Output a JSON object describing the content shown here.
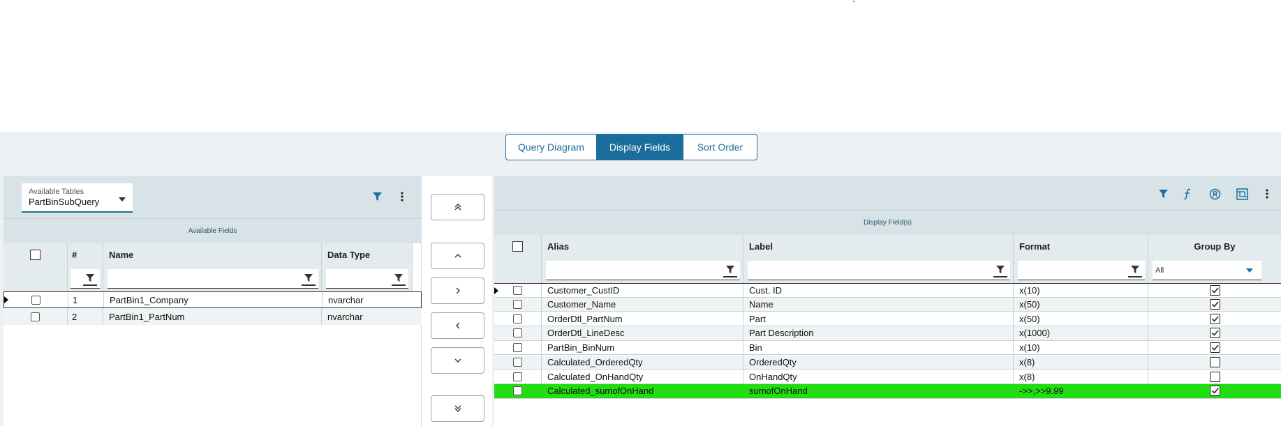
{
  "tabs": [
    {
      "label": "Query Diagram",
      "active": false
    },
    {
      "label": "Display Fields",
      "active": true
    },
    {
      "label": "Sort Order",
      "active": false
    }
  ],
  "left": {
    "table_select": {
      "label": "Available Tables",
      "value": "PartBinSubQuery"
    },
    "section_title": "Available Fields",
    "columns": [
      "#",
      "Name",
      "Data Type"
    ],
    "rows": [
      {
        "num": "1",
        "name": "PartBin1_Company",
        "type": "nvarchar"
      },
      {
        "num": "2",
        "name": "PartBin1_PartNum",
        "type": "nvarchar"
      }
    ]
  },
  "middle": {
    "buttons": [
      "move-all-up",
      "move-up",
      "add",
      "remove",
      "move-down",
      "move-all-down"
    ]
  },
  "right": {
    "section_title": "Display Field(s)",
    "columns": [
      "Alias",
      "Label",
      "Format",
      "Group By"
    ],
    "group_filter_value": "All",
    "rows": [
      {
        "alias": "Customer_CustID",
        "label": "Cust. ID",
        "format": "x(10)",
        "group_by": true
      },
      {
        "alias": "Customer_Name",
        "label": "Name",
        "format": "x(50)",
        "group_by": true
      },
      {
        "alias": "OrderDtl_PartNum",
        "label": "Part",
        "format": "x(50)",
        "group_by": true
      },
      {
        "alias": "OrderDtl_LineDesc",
        "label": "Part Description",
        "format": "x(1000)",
        "group_by": true
      },
      {
        "alias": "PartBin_BinNum",
        "label": "Bin",
        "format": "x(10)",
        "group_by": true
      },
      {
        "alias": "Calculated_OrderedQty",
        "label": "OrderedQty",
        "format": "x(8)",
        "group_by": false
      },
      {
        "alias": "Calculated_OnHandQty",
        "label": "OnHandQty",
        "format": "x(8)",
        "group_by": false
      },
      {
        "alias": "Calculated_sumofOnHand",
        "label": "sumofOnHand",
        "format": "->>,>>9.99",
        "group_by": true
      }
    ]
  },
  "colors": {
    "accent": "#1b6d9b",
    "highlight_row": "#22dd11",
    "panel_header": "#d8e3e8"
  },
  "icons": [
    "filter-icon",
    "more-vert-icon",
    "function-icon",
    "registered-icon",
    "calculated-field-icon",
    "chevron-double-up-icon",
    "chevron-up-icon",
    "chevron-right-icon",
    "chevron-left-icon",
    "chevron-down-icon",
    "chevron-double-down-icon"
  ]
}
